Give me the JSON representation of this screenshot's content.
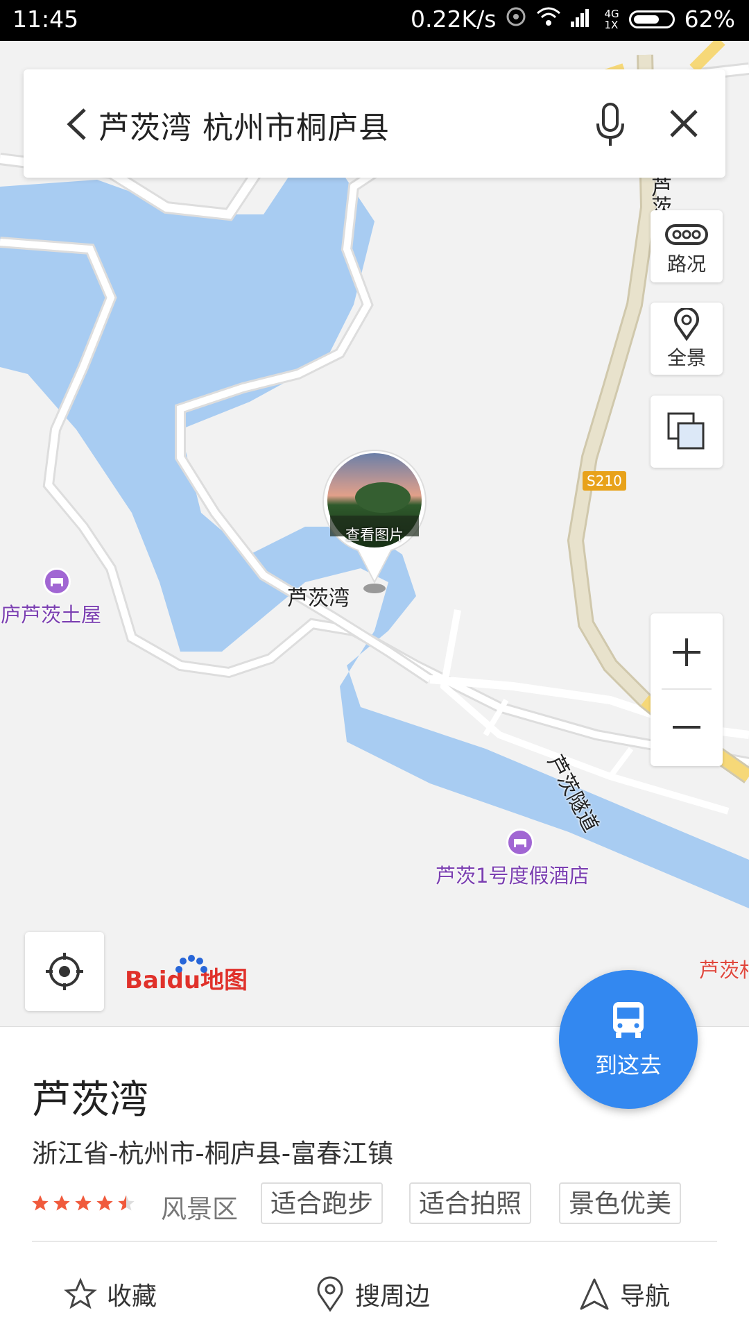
{
  "status_bar": {
    "time": "11:45",
    "net_speed": "0.22K/s",
    "network_type": "4G",
    "network_sub": "1X",
    "battery": "62%"
  },
  "search": {
    "query": "芦茨湾 杭州市桐庐县"
  },
  "tools": {
    "traffic": "路况",
    "panorama": "全景"
  },
  "map": {
    "pin_caption": "查看图片",
    "pin_label": "芦茨湾",
    "road_badge": "S210",
    "tunnel_name": "芦茨隧道",
    "tunnel_name_top": "芦茨隧道",
    "poi_hostel": "桐庐芦茨土屋",
    "poi_hotel": "芦茨1号度假酒店",
    "poi_edge": "芦茨村",
    "logo_text": "Baidu地图"
  },
  "place": {
    "name": "芦茨湾",
    "address": "浙江省-杭州市-桐庐县-富春江镇",
    "rating": 4.5,
    "category": "风景区",
    "tags": [
      "适合跑步",
      "适合拍照",
      "景色优美"
    ]
  },
  "actions": {
    "favorite": "收藏",
    "nearby": "搜周边",
    "navigate": "导航"
  },
  "go_button": {
    "label": "到这去"
  },
  "colors": {
    "water": "#a8ccf2",
    "land": "#f2f2f2",
    "road": "#ffffff",
    "highway": "#e4dcc4",
    "accent": "#3388f0",
    "poi": "#7b3fb1",
    "star": "#f05a3c"
  }
}
